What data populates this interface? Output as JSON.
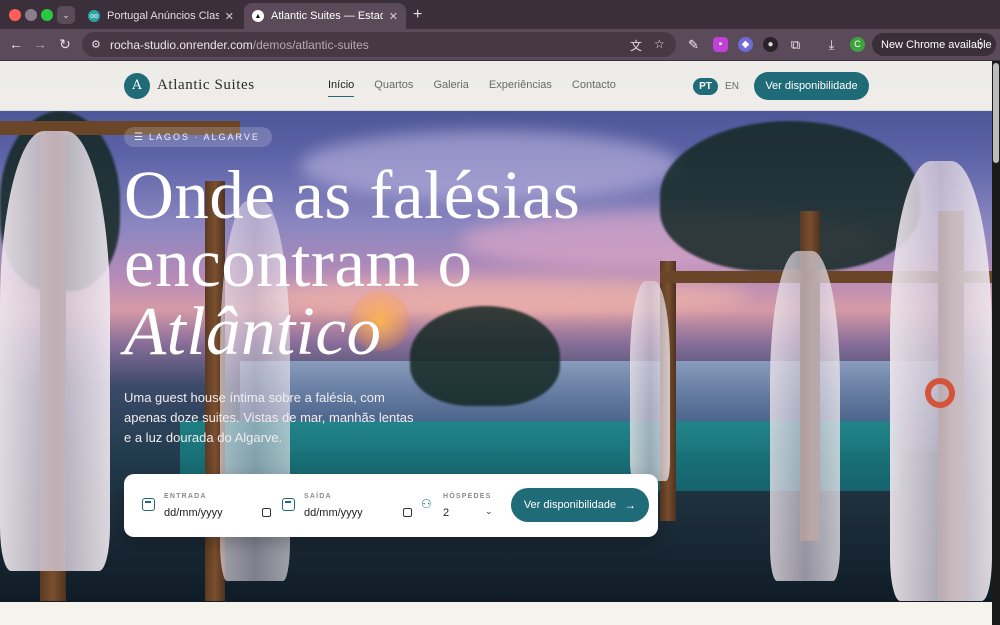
{
  "browser": {
    "tabs": [
      {
        "title": "Portugal Anúncios Classificados",
        "favicon": "oo",
        "active": false
      },
      {
        "title": "Atlantic Suites — Estadias Costeiras",
        "favicon": "▲",
        "active": true
      }
    ],
    "url_host": "rocha-studio.onrender.com",
    "url_path": "/demos/atlantic-suites",
    "profile_initial": "C",
    "update_label": "New Chrome available"
  },
  "site": {
    "logo_mark": "A",
    "logo_text": "Atlantic Suites",
    "nav": [
      "Início",
      "Quartos",
      "Galeria",
      "Experiências",
      "Contacto"
    ],
    "nav_active": "Início",
    "lang_active": "PT",
    "lang_other": "EN",
    "cta_label": "Ver disponibilidade",
    "accent_color": "#1f6b78"
  },
  "hero": {
    "location": "LAGOS · ALGARVE",
    "headline_line1": "Onde as falésias",
    "headline_line2": "encontram o",
    "headline_line3": "Atlântico",
    "subtitle": "Uma guest house íntima sobre a falésia, com apenas doze suites. Vistas de mar, manhãs lentas e a luz dourada do Algarve."
  },
  "booking": {
    "checkin_label": "ENTRADA",
    "checkin_value": "dd/mm/yyyy",
    "checkout_label": "SAÍDA",
    "checkout_value": "dd/mm/yyyy",
    "guests_label": "HÓSPEDES",
    "guests_value": "2",
    "submit_label": "Ver disponibilidade"
  }
}
